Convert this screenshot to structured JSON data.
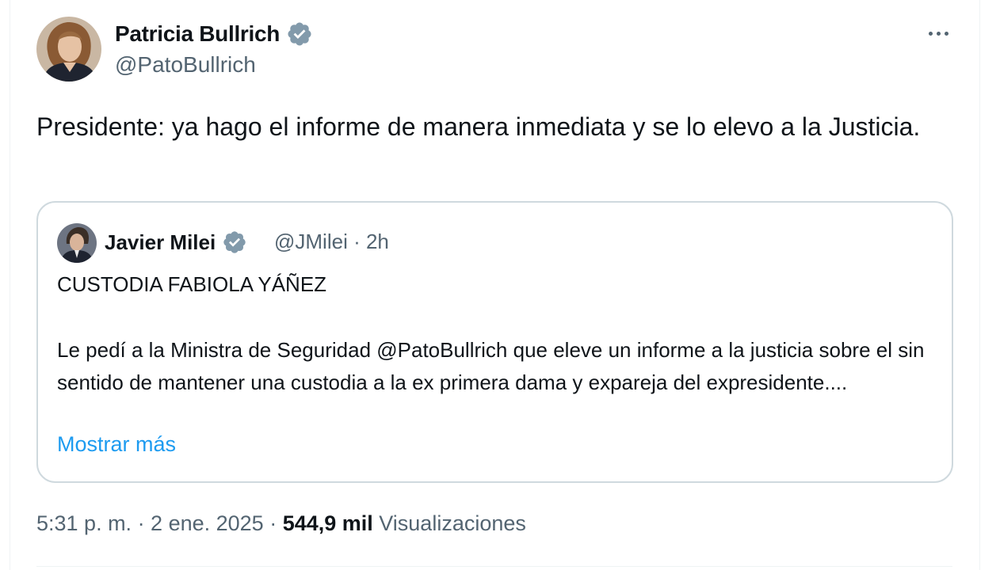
{
  "tweet": {
    "author": {
      "name": "Patricia Bullrich",
      "handle": "@PatoBullrich",
      "verified_icon": "verified-badge-icon"
    },
    "text": "Presidente: ya hago el informe de manera inmediata y se lo elevo a la Justicia.",
    "more_icon": "more-options-icon",
    "quoted": {
      "author_name": "Javier Milei",
      "meta": "@JMilei · 2h",
      "headline": "CUSTODIA FABIOLA YÁÑEZ",
      "body": "Le pedí a la Ministra de Seguridad @PatoBullrich que eleve un informe a la justicia sobre el sin sentido de mantener una custodia a la ex primera dama y expareja del expresidente....",
      "show_more": "Mostrar más"
    },
    "footer": {
      "timestamp": "5:31 p. m. · 2 ene. 2025 · ",
      "views_count": "544,9 mil",
      "views_label": " Visualizaciones"
    }
  },
  "colors": {
    "text_primary": "#0f1419",
    "text_secondary": "#536471",
    "link": "#1d9bf0",
    "border": "#cfd9de",
    "verified": "#829aab"
  }
}
